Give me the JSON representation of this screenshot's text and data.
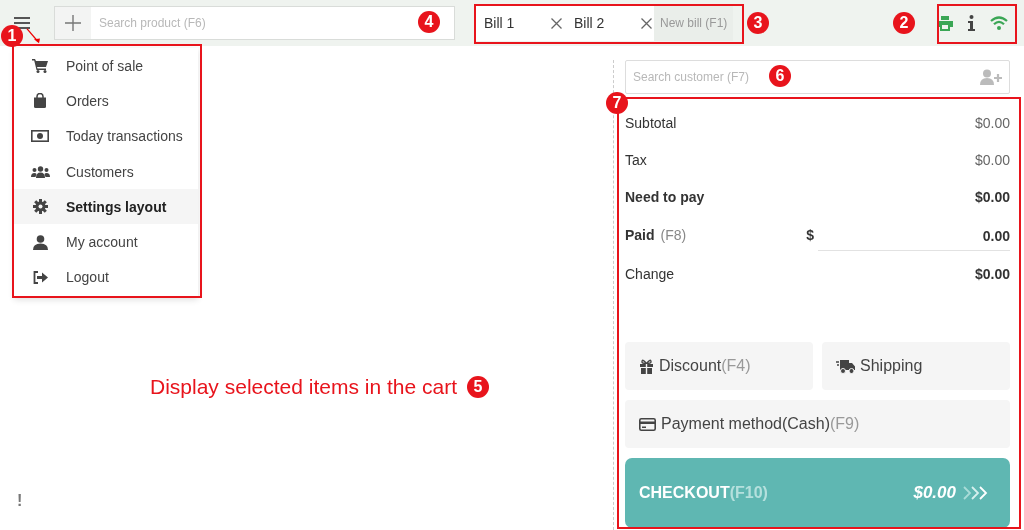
{
  "product_search": {
    "placeholder": "Search product (F6)"
  },
  "bills": [
    {
      "label": "Bill 1"
    },
    {
      "label": "Bill 2"
    }
  ],
  "new_bill": "New bill (F1)",
  "menu": {
    "items": [
      {
        "label": "Point of sale",
        "selected": false
      },
      {
        "label": "Orders",
        "selected": false
      },
      {
        "label": "Today transactions",
        "selected": false
      },
      {
        "label": "Customers",
        "selected": false
      },
      {
        "label": "Settings layout",
        "selected": true
      },
      {
        "label": "My account",
        "selected": false
      },
      {
        "label": "Logout",
        "selected": false
      }
    ]
  },
  "cart_caption": "Display selected items in the cart",
  "warning_mark": "!",
  "customer_search": {
    "placeholder": "Search customer (F7)"
  },
  "summary": [
    {
      "kind": "plain",
      "label": "Subtotal",
      "value": "$0.00"
    },
    {
      "kind": "plain",
      "label": "Tax",
      "value": "$0.00"
    },
    {
      "kind": "total",
      "label": "Need to pay",
      "value": "$0.00"
    },
    {
      "kind": "input",
      "label": "Paid",
      "hint": "(F8)",
      "currency": "$",
      "value": "0.00"
    },
    {
      "kind": "change",
      "label": "Change",
      "value": "$0.00"
    }
  ],
  "actions": [
    {
      "label": "Discount",
      "shortcut": "(F4)"
    },
    {
      "label": "Shipping"
    },
    {
      "label": "Payment method(Cash)",
      "shortcut": "(F9)"
    }
  ],
  "checkout": {
    "label": "CHECKOUT",
    "shortcut": "(F10)",
    "amount": "$0.00"
  },
  "annotations": [
    {
      "number": "4"
    },
    {
      "number": "3"
    },
    {
      "number": "2"
    },
    {
      "number": "1"
    },
    {
      "number": "6"
    },
    {
      "number": "7"
    },
    {
      "number": "5"
    }
  ]
}
